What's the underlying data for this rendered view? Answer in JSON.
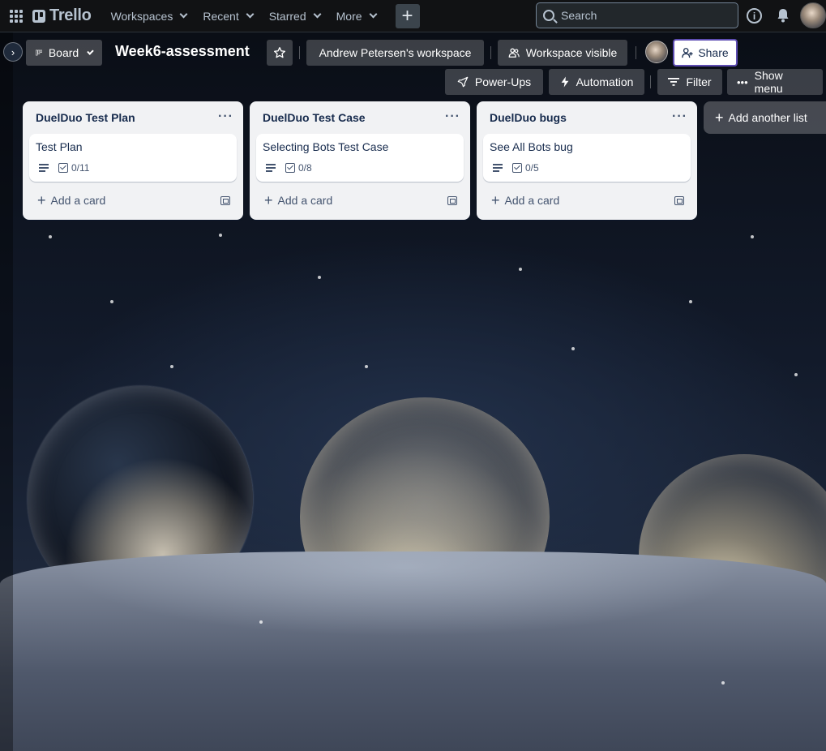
{
  "nav": {
    "brand": "Trello",
    "menus": [
      "Workspaces",
      "Recent",
      "Starred",
      "More"
    ],
    "create_label": "+",
    "search_placeholder": "Search"
  },
  "board": {
    "view_label": "Board",
    "title": "Week6-assessment",
    "workspace": "Andrew Petersen's workspace",
    "visibility": "Workspace visible",
    "share_label": "Share",
    "power_ups_label": "Power-Ups",
    "automation_label": "Automation",
    "filter_label": "Filter",
    "show_menu_label": "Show menu",
    "add_list_label": "Add another list"
  },
  "lists": [
    {
      "title": "DuelDuo Test Plan",
      "cards": [
        {
          "title": "Test Plan",
          "checklist": "0/11"
        }
      ],
      "add_card_label": "Add a card"
    },
    {
      "title": "DuelDuo Test Case",
      "cards": [
        {
          "title": "Selecting Bots Test Case",
          "checklist": "0/8"
        }
      ],
      "add_card_label": "Add a card"
    },
    {
      "title": "DuelDuo bugs",
      "cards": [
        {
          "title": "See All Bots bug",
          "checklist": "0/5"
        }
      ],
      "add_card_label": "Add a card"
    }
  ],
  "colors": {
    "topbar": "#111214",
    "list_bg": "#f1f2f4",
    "share_border": "#5e4db2"
  }
}
